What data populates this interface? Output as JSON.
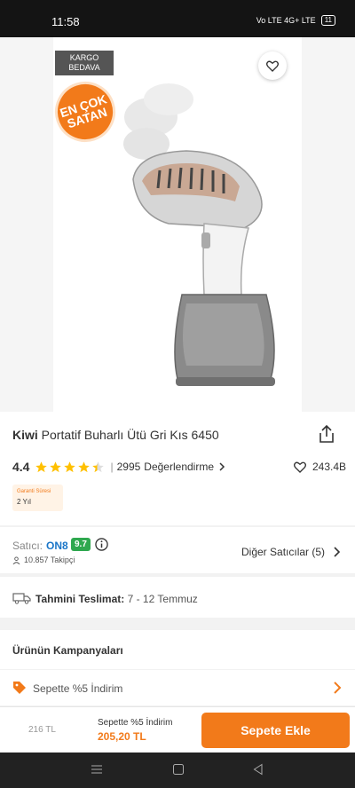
{
  "status_bar": {
    "time": "11:58",
    "signal": "Vo LTE 4G+ LTE",
    "battery": "11"
  },
  "badges": {
    "kargo": "KARGO\nBEDAVA",
    "best_seller": "EN ÇOK SATAN"
  },
  "product": {
    "brand": "Kiwi",
    "name": "Portatif Buharlı Ütü Gri Kıs 6450",
    "rating": "4.4",
    "stars": 4.4,
    "review_count": "2995",
    "review_label": "Değerlendirme",
    "likes": "243.4B",
    "warranty_label": "Garanti Süresi",
    "warranty_value": "2 Yıl"
  },
  "seller": {
    "label": "Satıcı:",
    "name": "ON8",
    "score": "9.7",
    "followers": "10.857 Takipçi",
    "other_sellers": "Diğer Satıcılar (5)"
  },
  "delivery": {
    "label": "Tahmini Teslimat:",
    "value": "7 - 12 Temmuz"
  },
  "campaigns": {
    "header": "Ürünün Kampanyaları",
    "item": "Sepette %5 İndirim"
  },
  "bottom_bar": {
    "old_price": "216 TL",
    "promo": "Sepette %5 İndirim",
    "new_price": "205,20 TL",
    "cta": "Sepete Ekle"
  },
  "colors": {
    "accent": "#f27a1a",
    "seller_link": "#1a76c8",
    "score_green": "#2fa84f"
  }
}
